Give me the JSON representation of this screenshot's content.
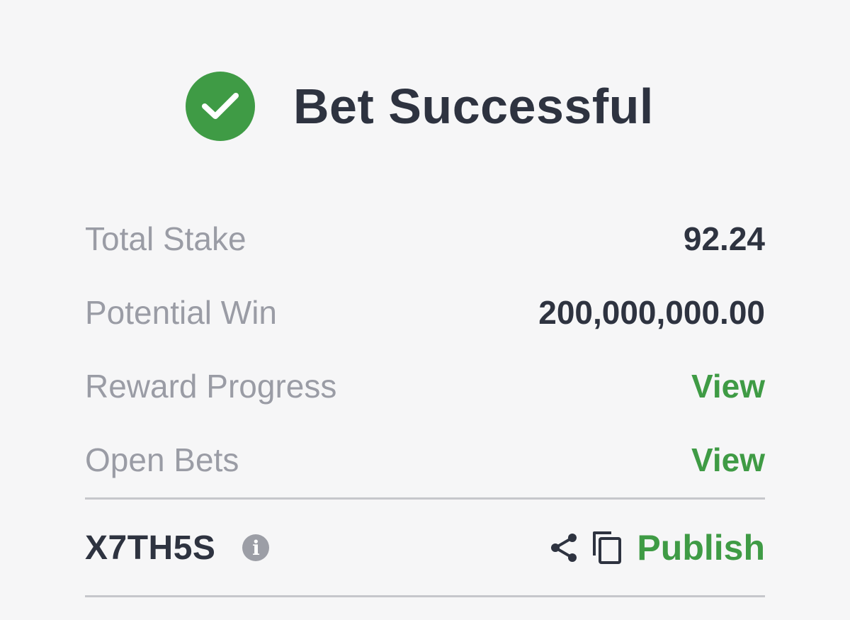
{
  "colors": {
    "success_green": "#3f9b45",
    "text_dark": "#2e3340",
    "text_muted": "#9a9ca5"
  },
  "header": {
    "icon": "check-circle-icon",
    "title": "Bet Successful"
  },
  "summary": {
    "total_stake_label": "Total Stake",
    "total_stake_value": "92.24",
    "potential_win_label": "Potential Win",
    "potential_win_value": "200,000,000.00",
    "reward_progress_label": "Reward Progress",
    "reward_progress_link": "View",
    "open_bets_label": "Open Bets",
    "open_bets_link": "View"
  },
  "booking": {
    "code": "X7TH5S",
    "info_icon": "info-icon",
    "share_icon": "share-icon",
    "copy_icon": "copy-icon",
    "publish_label": "Publish"
  }
}
